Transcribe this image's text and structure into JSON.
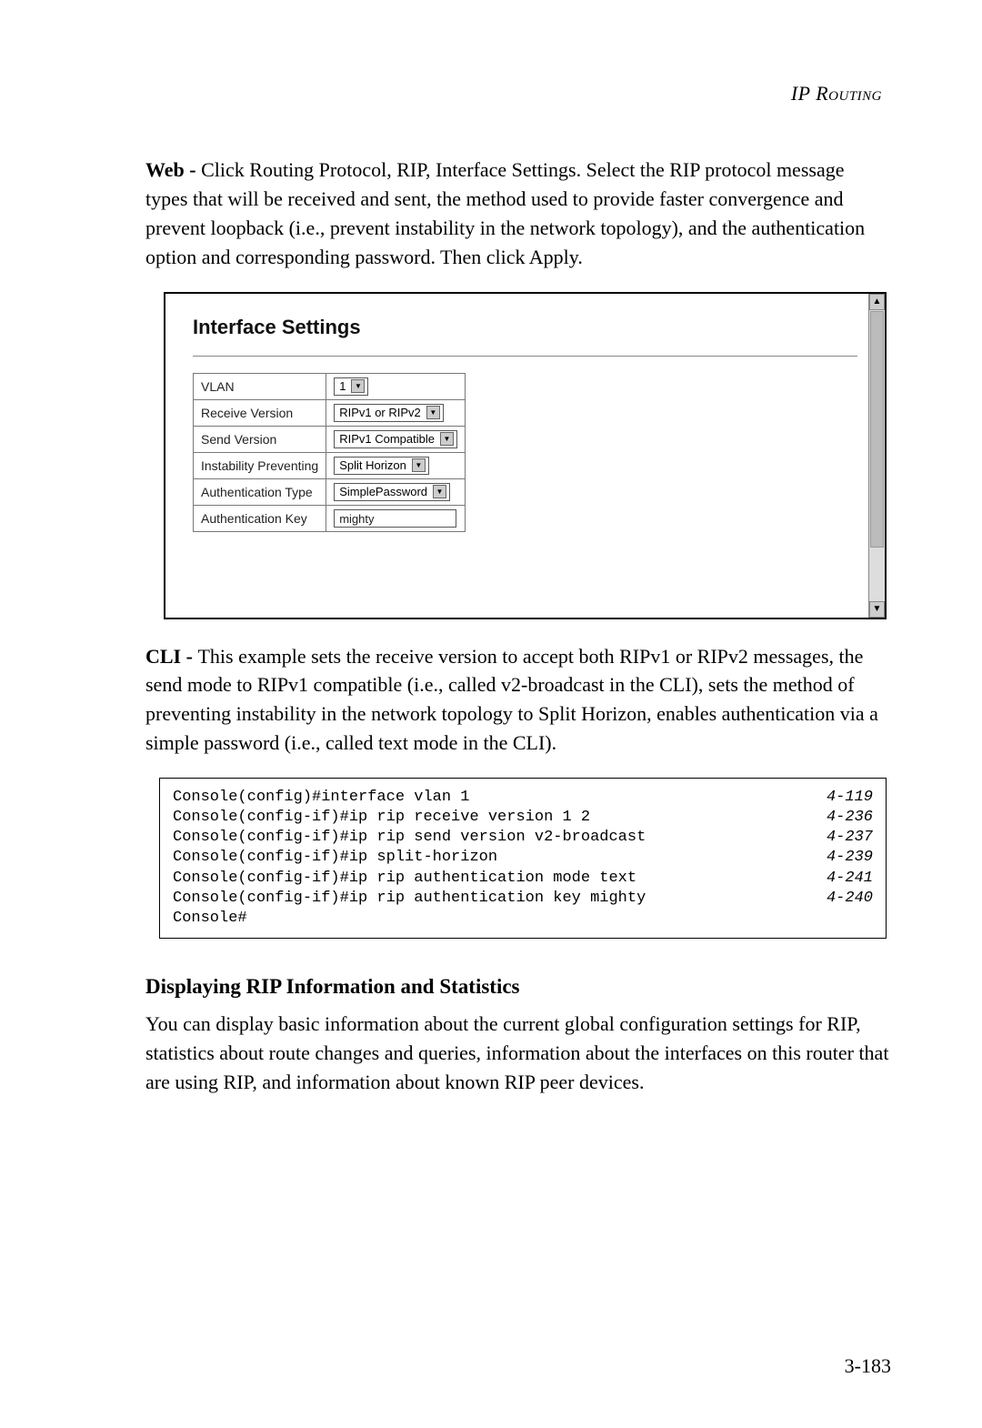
{
  "header": {
    "title": "IP Routing"
  },
  "para1": {
    "lead": "Web - ",
    "text": "Click Routing Protocol, RIP, Interface Settings. Select the RIP protocol message types that will be received and sent, the method used to provide faster convergence and prevent loopback (i.e., prevent instability in the network topology), and the authentication option and corresponding password. Then click Apply."
  },
  "panel": {
    "title": "Interface Settings",
    "rows": [
      {
        "label": "VLAN",
        "value": "1",
        "type": "select"
      },
      {
        "label": "Receive Version",
        "value": "RIPv1 or RIPv2",
        "type": "select"
      },
      {
        "label": "Send Version",
        "value": "RIPv1 Compatible",
        "type": "select"
      },
      {
        "label": "Instability Preventing",
        "value": "Split Horizon",
        "type": "select"
      },
      {
        "label": "Authentication Type",
        "value": "SimplePassword",
        "type": "select"
      },
      {
        "label": "Authentication Key",
        "value": "mighty",
        "type": "text"
      }
    ]
  },
  "para2": {
    "lead": "CLI - ",
    "text": "This example sets the receive version to accept both RIPv1 or RIPv2 messages, the send mode to RIPv1 compatible (i.e., called v2-broadcast in the CLI), sets the method of preventing instability in the network topology to Split Horizon, enables authentication via a simple password (i.e., called text mode in the CLI)."
  },
  "cli": {
    "lines": [
      {
        "cmd": "Console(config)#interface vlan 1",
        "ref": "4-119"
      },
      {
        "cmd": "Console(config-if)#ip rip receive version 1 2",
        "ref": "4-236"
      },
      {
        "cmd": "Console(config-if)#ip rip send version v2-broadcast",
        "ref": "4-237"
      },
      {
        "cmd": "Console(config-if)#ip split-horizon",
        "ref": "4-239"
      },
      {
        "cmd": "Console(config-if)#ip rip authentication mode text",
        "ref": "4-241"
      },
      {
        "cmd": "Console(config-if)#ip rip authentication key mighty",
        "ref": "4-240"
      },
      {
        "cmd": "Console#",
        "ref": ""
      }
    ]
  },
  "subhead": "Displaying RIP Information and Statistics",
  "para3": "You can display basic information about the current global configuration settings for RIP, statistics about route changes and queries, information about the interfaces on this router that are using RIP, and information about known RIP peer devices.",
  "page_number": "3-183",
  "glyphs": {
    "down": "▼",
    "up": "▲"
  }
}
